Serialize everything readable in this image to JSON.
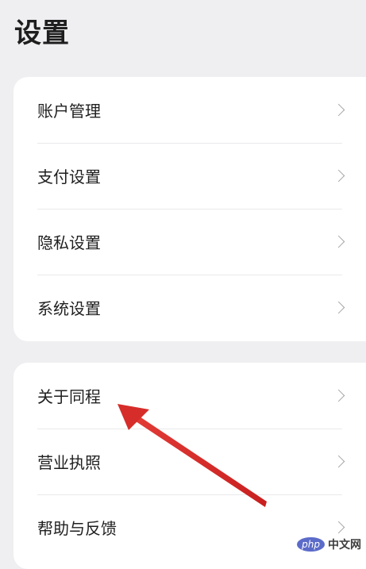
{
  "header": {
    "title": "设置"
  },
  "groups": [
    {
      "items": [
        {
          "label": "账户管理",
          "icon": "chevron-right-icon"
        },
        {
          "label": "支付设置",
          "icon": "chevron-right-icon"
        },
        {
          "label": "隐私设置",
          "icon": "chevron-right-icon"
        },
        {
          "label": "系统设置",
          "icon": "chevron-right-icon"
        }
      ]
    },
    {
      "items": [
        {
          "label": "关于同程",
          "icon": "chevron-right-icon"
        },
        {
          "label": "营业执照",
          "icon": "chevron-right-icon"
        },
        {
          "label": "帮助与反馈",
          "icon": "chevron-right-icon"
        }
      ]
    }
  ],
  "annotation": {
    "arrow_color": "#d32a2a",
    "points_to": "关于同程"
  },
  "watermark": {
    "logo": "php",
    "text": "中文网"
  }
}
